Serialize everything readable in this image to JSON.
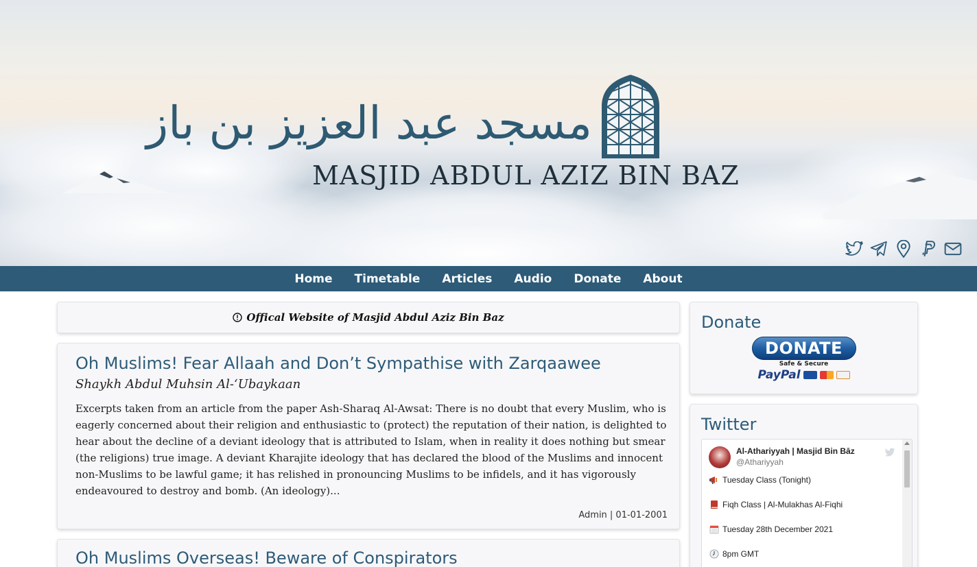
{
  "site": {
    "logo_arabic": "مسجد عبد العزيز بن باز",
    "logo_latin": "MASJID ABDUL AZIZ BIN BAZ"
  },
  "social": {
    "icons": [
      "twitter-icon",
      "telegram-icon",
      "location-pin-icon",
      "paypal-icon",
      "mail-icon"
    ]
  },
  "nav": {
    "items": [
      "Home",
      "Timetable",
      "Articles",
      "Audio",
      "Donate",
      "About"
    ]
  },
  "notice": {
    "text": "Offical Website of Masjid Abdul Aziz Bin Baz"
  },
  "articles": [
    {
      "title": "Oh Muslims! Fear Allaah and Don’t Sympathise with Zarqaawee",
      "author": "Shaykh Abdul Muhsin Al-‘Ubaykaan",
      "excerpt": "Excerpts taken from an article from the paper Ash-Sharaq Al-Awsat: There is no doubt that every Muslim, who is eagerly concerned about their religion and enthusiastic to (protect) the reputation of their nation, is delighted to hear about the decline of a deviant ideology that is attributed to Islam, when in reality it does nothing but smear (the religions) true image. A deviant Kharajite ideology that has declared the blood of the Muslims and innocent non-Muslims to be lawful game; it has relished in pronouncing Muslims to be infidels, and it has vigorously endeavoured to destroy and bomb. (An ideology)...",
      "meta": "Admin | 01-01-2001"
    },
    {
      "title": "Oh Muslims Overseas! Beware of Conspirators"
    }
  ],
  "sidebar": {
    "donate": {
      "heading": "Donate",
      "button_label": "DONATE",
      "safe_text": "Safe & Secure",
      "paypal_text": "PayPal"
    },
    "twitter": {
      "heading": "Twitter",
      "account_name": "Al-Athariyyah | Masjid Bin Bāz",
      "account_handle": "@Athariyyah",
      "lines": [
        {
          "icon": "megaphone-icon",
          "text": "Tuesday Class (Tonight)"
        },
        {
          "icon": "book-icon",
          "text": "Fiqh Class | Al-Mulakhas Al-Fiqhi"
        },
        {
          "icon": "calendar-icon",
          "text": "Tuesday 28th December 2021"
        },
        {
          "icon": "clock-icon",
          "text": "8pm GMT"
        }
      ]
    }
  },
  "colors": {
    "brand": "#2d5b78",
    "nav_bg": "#2d5b78",
    "card_bg": "#f7f7f9"
  }
}
